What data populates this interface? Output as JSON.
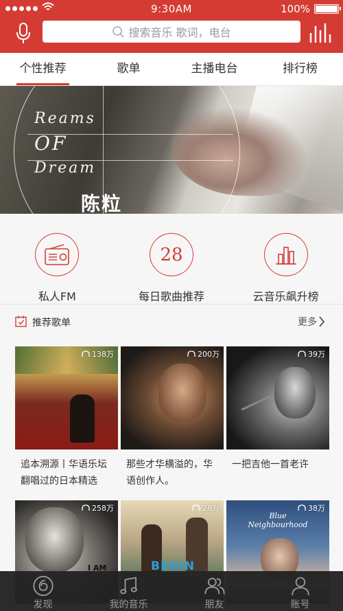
{
  "status_bar": {
    "time": "9:30AM",
    "battery": "100%"
  },
  "search": {
    "placeholder": "搜索音乐 歌词，电台"
  },
  "tabs": [
    {
      "label": "个性推荐",
      "active": true
    },
    {
      "label": "歌单",
      "active": false
    },
    {
      "label": "主播电台",
      "active": false
    },
    {
      "label": "排行榜",
      "active": false
    }
  ],
  "banner": {
    "script_line1": "Reams",
    "script_line2": "OF",
    "script_line3": "Dream",
    "artist": "陈粒"
  },
  "quick_entries": [
    {
      "label": "私人FM",
      "icon": "radio-icon"
    },
    {
      "label": "每日歌曲推荐",
      "icon": "calendar-icon",
      "number": "28"
    },
    {
      "label": "云音乐飙升榜",
      "icon": "chart-icon"
    }
  ],
  "section": {
    "title": "推荐歌单",
    "more": "更多"
  },
  "playlists": [
    {
      "count": "138万",
      "title": "追本溯源丨华语乐坛翻唱过的日本精选"
    },
    {
      "count": "200万",
      "title": "那些才华横溢的，华语创作人。"
    },
    {
      "count": "39万",
      "title": "一把吉他一首老许"
    },
    {
      "count": "258万",
      "title": ""
    },
    {
      "count": "28万",
      "title": ""
    },
    {
      "count": "38万",
      "title": ""
    }
  ],
  "cover_text": {
    "c4": "I AM",
    "c5": "BEGIN",
    "c6": "Blue Neighbourhood"
  },
  "bottom_nav": [
    {
      "label": "发现",
      "icon": "netease-logo-icon",
      "active": true
    },
    {
      "label": "我的音乐",
      "icon": "music-note-icon",
      "active": false
    },
    {
      "label": "朋友",
      "icon": "friends-icon",
      "active": false
    },
    {
      "label": "账号",
      "icon": "account-icon",
      "active": false
    }
  ],
  "colors": {
    "brand_red": "#d43c33",
    "nav_bg": "#222222"
  }
}
